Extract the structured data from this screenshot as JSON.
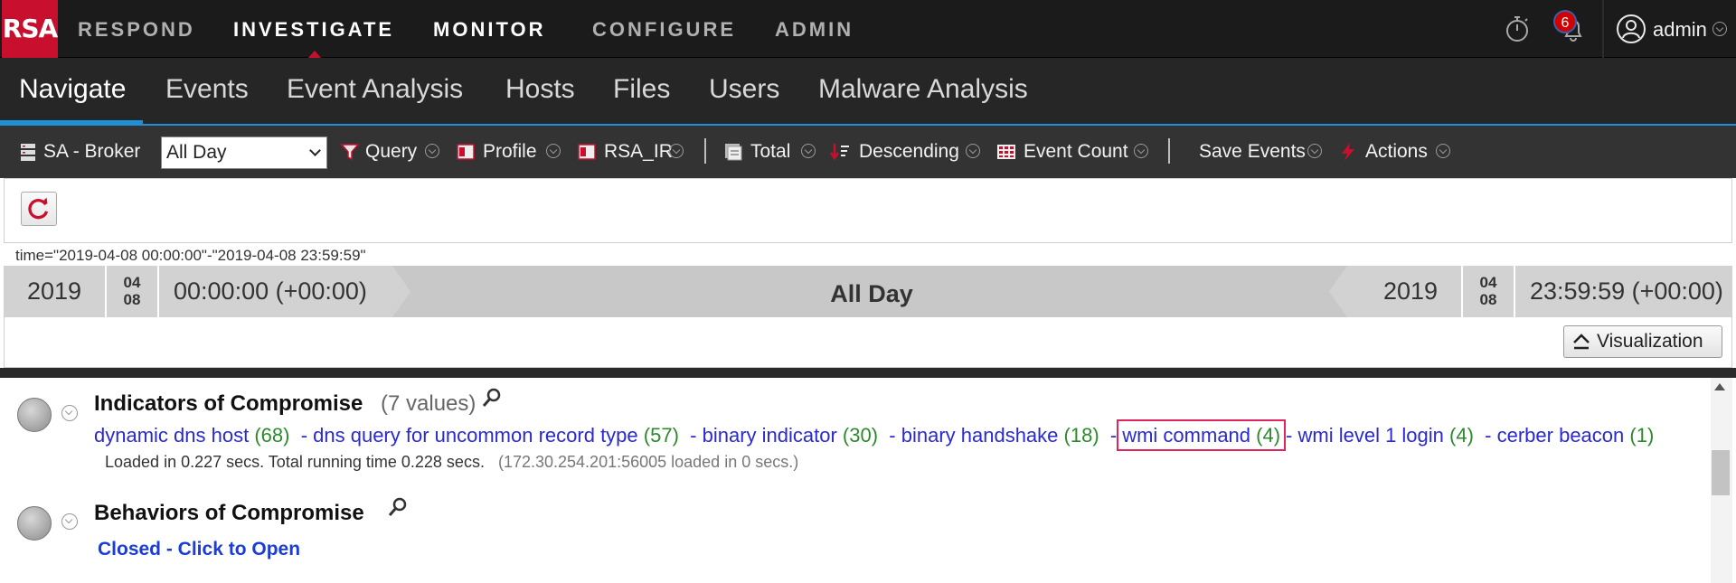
{
  "logo": "RSA",
  "top_nav": {
    "items": [
      "RESPOND",
      "INVESTIGATE",
      "MONITOR",
      "CONFIGURE",
      "ADMIN"
    ],
    "active": "INVESTIGATE",
    "notification_count": "6",
    "user": "admin"
  },
  "sub_nav": {
    "items": [
      "Navigate",
      "Events",
      "Event Analysis",
      "Hosts",
      "Files",
      "Users",
      "Malware Analysis"
    ],
    "active": "Navigate"
  },
  "toolbar": {
    "service": "SA - Broker",
    "time_range": "All Day",
    "query": "Query",
    "profile": "Profile",
    "rsa_ir": "RSA_IR",
    "total": "Total",
    "descending": "Descending",
    "event_count": "Event Count",
    "save_events": "Save Events",
    "actions": "Actions"
  },
  "query_text": "time=\"2019-04-08 00:00:00\"-\"2019-04-08 23:59:59\"",
  "timebar": {
    "start_year": "2019",
    "start_month": "04",
    "start_day": "08",
    "start_time": "00:00:00 (+00:00)",
    "label": "All Day",
    "end_year": "2019",
    "end_month": "04",
    "end_day": "08",
    "end_time": "23:59:59 (+00:00)"
  },
  "visualization_button": "Visualization",
  "ioc": {
    "title": "Indicators of Compromise",
    "count": "(7 values)",
    "values": [
      {
        "name": "dynamic dns host",
        "count": "(68)"
      },
      {
        "name": "dns query for uncommon record type",
        "count": "(57)"
      },
      {
        "name": "binary indicator",
        "count": "(30)"
      },
      {
        "name": "binary handshake",
        "count": "(18)"
      },
      {
        "name": "wmi command",
        "count": "(4)"
      },
      {
        "name": "wmi level 1 login",
        "count": "(4)"
      },
      {
        "name": "cerber beacon",
        "count": "(1)"
      }
    ],
    "separator": "-",
    "loaded": "Loaded in 0.227 secs. Total running time 0.228 secs.",
    "loaded_source": "(172.30.254.201:56005 loaded in 0 secs.)"
  },
  "boc": {
    "title": "Behaviors of Compromise",
    "closed_label": "Closed - Click to Open"
  },
  "colors": {
    "brand": "#c8102e",
    "accent": "#1f8fd6",
    "link": "#2a2ad0",
    "count": "#2c8a2c",
    "highlight": "#e0245e"
  }
}
